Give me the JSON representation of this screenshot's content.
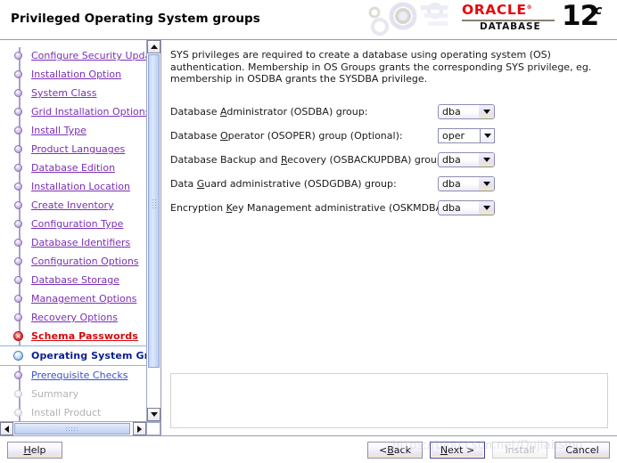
{
  "header": {
    "title": "Privileged Operating System groups",
    "logo": {
      "brand": "ORACLE",
      "trademark": "®",
      "product": "DATABASE",
      "version": "12",
      "version_suffix": "c"
    },
    "gears_icon": "gears-graphic"
  },
  "sidebar": {
    "steps": [
      {
        "label": "Configure Security Updates",
        "state": "done"
      },
      {
        "label": "Installation Option",
        "state": "done"
      },
      {
        "label": "System Class",
        "state": "done"
      },
      {
        "label": "Grid Installation Options",
        "state": "done"
      },
      {
        "label": "Install Type",
        "state": "done"
      },
      {
        "label": "Product Languages",
        "state": "done"
      },
      {
        "label": "Database Edition",
        "state": "done"
      },
      {
        "label": "Installation Location",
        "state": "done"
      },
      {
        "label": "Create Inventory",
        "state": "done"
      },
      {
        "label": "Configuration Type",
        "state": "done"
      },
      {
        "label": "Database Identifiers",
        "state": "done"
      },
      {
        "label": "Configuration Options",
        "state": "done"
      },
      {
        "label": "Database Storage",
        "state": "done"
      },
      {
        "label": "Management Options",
        "state": "done"
      },
      {
        "label": "Recovery Options",
        "state": "done"
      },
      {
        "label": "Schema Passwords",
        "state": "error"
      },
      {
        "label": "Operating System Groups",
        "state": "current"
      },
      {
        "label": "Prerequisite Checks",
        "state": "upcoming"
      },
      {
        "label": "Summary",
        "state": "disabled"
      },
      {
        "label": "Install Product",
        "state": "disabled"
      }
    ],
    "vertical_scrollbar": {
      "up_icon": "scroll-up-arrow-icon",
      "down_icon": "scroll-down-arrow-icon"
    },
    "horizontal_scrollbar": {
      "left_icon": "scroll-left-arrow-icon",
      "right_icon": "scroll-right-arrow-icon"
    }
  },
  "main": {
    "description": "SYS privileges are required to create a database using operating system (OS) authentication. Membership in OS Groups grants the corresponding SYS privilege, eg. membership in OSDBA grants the SYSDBA privilege.",
    "fields": [
      {
        "label_before": "Database ",
        "mnemonic": "A",
        "label_after": "dministrator (OSDBA) group:",
        "value": "dba",
        "style": "styled",
        "name": "osdba-group-select"
      },
      {
        "label_before": "Database ",
        "mnemonic": "O",
        "label_after": "perator (OSOPER) group (Optional):",
        "value": "oper",
        "style": "plain",
        "name": "osoper-group-select"
      },
      {
        "label_before": "Database Backup and ",
        "mnemonic": "R",
        "label_after": "ecovery (OSBACKUPDBA) group:",
        "value": "dba",
        "style": "styled",
        "name": "osbackupdba-group-select"
      },
      {
        "label_before": "Data ",
        "mnemonic": "G",
        "label_after": "uard administrative (OSDGDBA) group:",
        "value": "dba",
        "style": "styled",
        "name": "osdgdba-group-select"
      },
      {
        "label_before": "Encryption ",
        "mnemonic": "K",
        "label_after": "ey Management administrative (OSKMDBA) group:",
        "value": "dba",
        "style": "styled",
        "name": "oskmdba-group-select"
      }
    ],
    "message_panel": ""
  },
  "footer": {
    "help": "Help",
    "back": "< Back",
    "back_before": "< ",
    "back_mnemonic": "B",
    "back_after": "ack",
    "next_before": "",
    "next_mnemonic": "N",
    "next_after": "ext >",
    "install": "Install",
    "cancel": "Cancel",
    "watermark": "https://blog.csdn.net/Dujiahsing"
  },
  "colors": {
    "oracle_red": "#E8050A",
    "link_purple": "#7b2fb5",
    "error_red": "#d6070b",
    "current_blue": "#0a1f8f",
    "upcoming_blue": "#3a4fd0",
    "disabled_gray": "#b3b3b8"
  }
}
